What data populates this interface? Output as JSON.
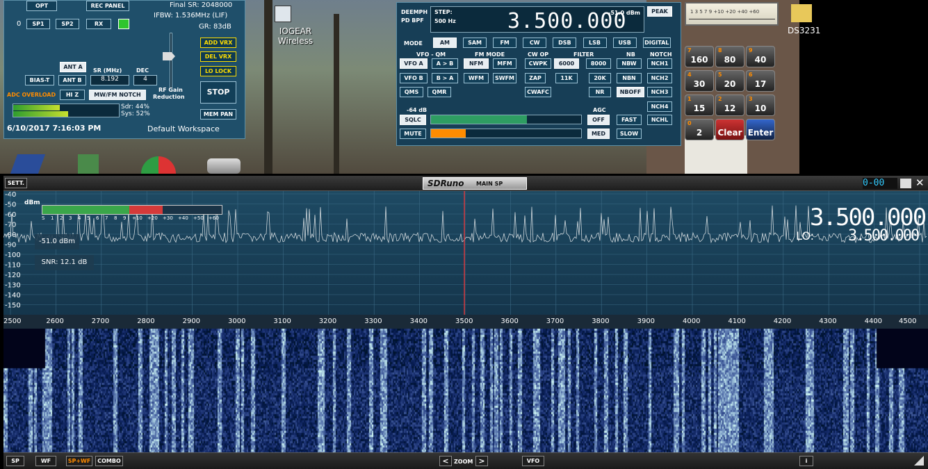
{
  "desktop": {
    "icon_label": "IOGEAR Wireless",
    "ds_label": "DS3231"
  },
  "main_panel": {
    "opt": "OPT",
    "rec_panel": "REC PANEL",
    "final_sr": "Final SR: 2048000",
    "ifbw": "IFBW: 1.536MHz (LIF)",
    "gr": "GR: 83dB",
    "sp_index": "0",
    "sp1": "SP1",
    "sp2": "SP2",
    "rx": "RX",
    "add_vrx": "ADD VRX",
    "del_vrx": "DEL VRX",
    "lo_lock": "LO LOCK",
    "stop": "STOP",
    "mem_pan": "MEM PAN",
    "ant_a": "ANT A",
    "sr_label": "SR (MHz)",
    "dec_label": "DEC",
    "bias_t": "BIAS-T",
    "ant_b": "ANT B",
    "sr_value": "8.192",
    "dec_value": "4",
    "adc_overload": "ADC OVERLOAD",
    "hi_z": "HI Z",
    "mw_fm_notch": "MW/FM NOTCH",
    "rf_gain": "RF Gain",
    "reduction": "Reduction",
    "sdr": "Sdr: 44%",
    "sys": "Sys: 52%",
    "datetime": "6/10/2017 7:16:03 PM",
    "workspace": "Default Workspace"
  },
  "rx_panel": {
    "deemph": "DEEMPH",
    "pd_bpf": "PD BPF",
    "step": "STEP:",
    "step_value": "500 Hz",
    "frequency": "3.500.000",
    "level": "-51.0 dBm",
    "peak": "PEAK",
    "mode": "MODE",
    "modes": [
      "AM",
      "SAM",
      "FM",
      "CW",
      "DSB",
      "LSB",
      "USB",
      "DIGITAL"
    ],
    "vfo_qm": "VFO - QM",
    "fm_mode": "FM MODE",
    "cw_op": "CW OP",
    "filter": "FILTER",
    "nb": "NB",
    "notch": "NOTCH",
    "vfo_a": "VFO A",
    "a_to_b": "A > B",
    "nfm": "NFM",
    "mfm": "MFM",
    "cwpk": "CWPK",
    "f6000": "6000",
    "f8000": "8000",
    "nbw": "NBW",
    "nch1": "NCH1",
    "vfo_b": "VFO B",
    "b_to_a": "B > A",
    "wfm": "WFM",
    "swfm": "SWFM",
    "zap": "ZAP",
    "f11k": "11K",
    "f20k": "20K",
    "nbn": "NBN",
    "nch2": "NCH2",
    "qms": "QMS",
    "qmr": "QMR",
    "cwafc": "CWAFC",
    "nr": "NR",
    "nboff": "NBOFF",
    "nch3": "NCH3",
    "nch4": "NCH4",
    "sq_level": "-64 dB",
    "agc": "AGC",
    "sqlc": "SQLC",
    "off": "OFF",
    "fast": "FAST",
    "nchl": "NCHL",
    "mute": "MUTE",
    "med": "MED",
    "slow": "SLOW",
    "meter_scale": "1 3 5 7 9 +10 +20 +40 +60",
    "keys": [
      {
        "sub": "7",
        "main": "160"
      },
      {
        "sub": "8",
        "main": "80"
      },
      {
        "sub": "9",
        "main": "40"
      },
      {
        "sub": "4",
        "main": "30"
      },
      {
        "sub": "5",
        "main": "20"
      },
      {
        "sub": "6",
        "main": "17"
      },
      {
        "sub": "1",
        "main": "15"
      },
      {
        "sub": "2",
        "main": "12"
      },
      {
        "sub": "3",
        "main": "10"
      },
      {
        "sub": "0",
        "main": "2"
      },
      {
        "sub": "",
        "main": "Clear"
      },
      {
        "sub": "",
        "main": "Enter"
      }
    ]
  },
  "spectrum": {
    "sett": "SETT.",
    "title": "SDRuno",
    "subtitle": "MAIN SP",
    "clock": "0-00",
    "unit": "dBm",
    "y_labels": [
      "-40",
      "-50",
      "-60",
      "-70",
      "-80",
      "-90",
      "-100",
      "-110",
      "-120",
      "-130",
      "-140",
      "-150"
    ],
    "s_scale": [
      "S",
      "1",
      "2",
      "3",
      "4",
      "5",
      "6",
      "7",
      "8",
      "9",
      "+10",
      "+20",
      "+30",
      "+40",
      "+50",
      "+60"
    ],
    "signal": "-51.0 dBm",
    "snr": "SNR: 12.1 dB",
    "freq_big": "3.500.000",
    "lo_label": "LO:",
    "lo_freq": "3.500.000",
    "x_labels": [
      "2500",
      "2600",
      "2700",
      "2800",
      "2900",
      "3000",
      "3100",
      "3200",
      "3300",
      "3400",
      "3500",
      "3600",
      "3700",
      "3800",
      "3900",
      "4000",
      "4100",
      "4200",
      "4300",
      "4400",
      "4500"
    ]
  },
  "bottom": {
    "sp": "SP",
    "wf": "WF",
    "spwf": "SP+WF",
    "combo": "COMBO",
    "zoom_left": "<",
    "zoom": "ZOOM",
    "zoom_right": ">",
    "vfo": "VFO",
    "info": "i"
  },
  "colors": {
    "panel": "#1f4f6a",
    "accent_orange": "#ff8c00",
    "meter_green": "#3aa64a",
    "meter_red": "#d43a3a",
    "trace": "#d0d8dc",
    "center_line": "#ff3030"
  }
}
